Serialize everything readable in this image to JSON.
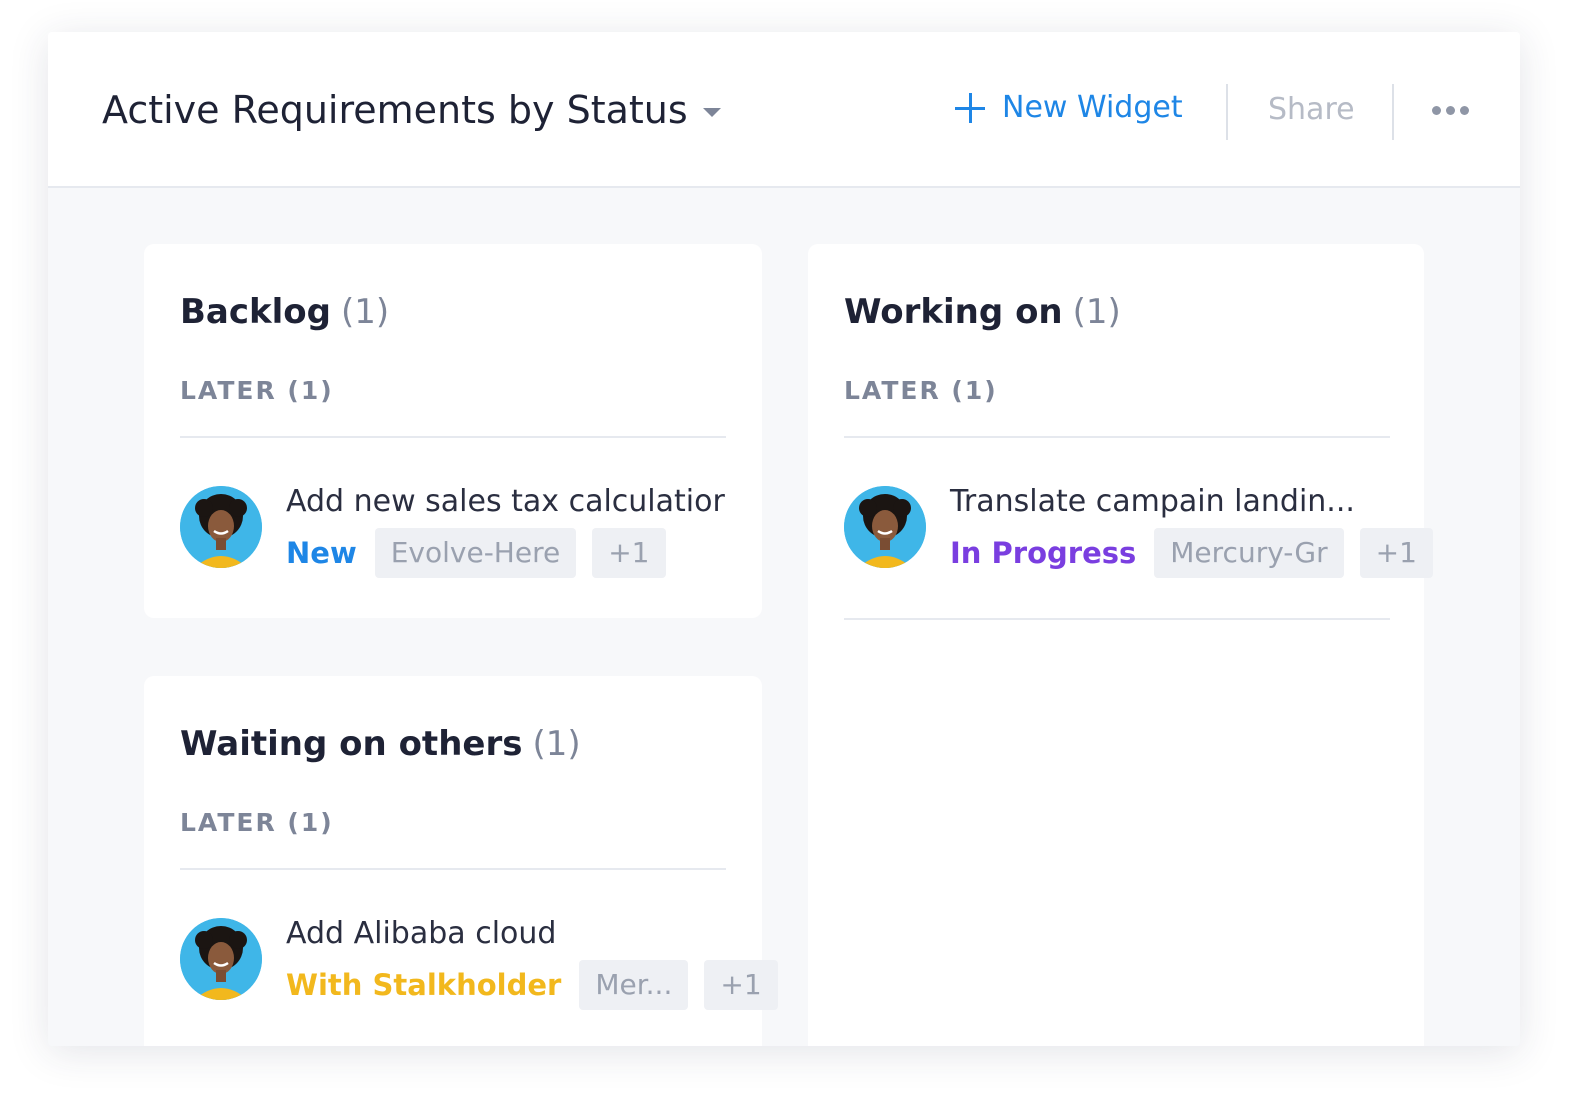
{
  "header": {
    "title": "Active Requirements by Status",
    "new_widget_label": "New Widget",
    "share_label": "Share"
  },
  "colors": {
    "new": "#1e86e6",
    "in_progress": "#7a3ee0",
    "with_stakeholder": "#f2b81d",
    "avatar_bg": "#3fb6e8"
  },
  "columns": [
    {
      "title": "Backlog",
      "count": "(1)",
      "group_label": "LATER (1)",
      "item": {
        "title": "Add new sales tax calculatior",
        "status": "New",
        "tags": [
          "Evolve-Here",
          "+1"
        ]
      }
    },
    {
      "title": "Working on",
      "count": "(1)",
      "group_label": "LATER (1)",
      "item": {
        "title": "Translate campain landin...",
        "status": "In Progress",
        "tags": [
          "Mercury-Gr",
          "+1"
        ]
      }
    },
    {
      "title": "Waiting on others",
      "count": "(1)",
      "group_label": "LATER (1)",
      "item": {
        "title": "Add Alibaba cloud",
        "status": "With Stalkholder",
        "tags": [
          "Mer...",
          "+1"
        ]
      }
    }
  ]
}
